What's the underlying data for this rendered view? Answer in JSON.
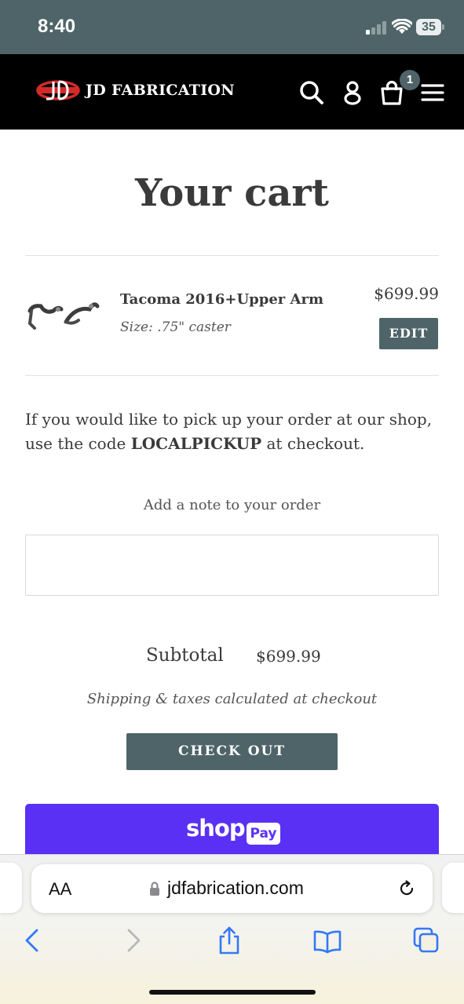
{
  "status_bar": {
    "time": "8:40",
    "battery": "35"
  },
  "header": {
    "brand": "JD FABRICATION",
    "cart_count": "1"
  },
  "cart": {
    "title": "Your cart",
    "items": [
      {
        "name": "Tacoma 2016+Upper Arm",
        "variant": "Size: .75\" caster",
        "price": "$699.99",
        "edit_label": "EDIT"
      }
    ],
    "notice_before": "If you would like to pick up your order at our shop, use the code ",
    "notice_code": "LOCALPICKUP",
    "notice_after": " at checkout.",
    "note_label": "Add a note to your order",
    "note_value": "",
    "subtotal_label": "Subtotal",
    "subtotal_value": "$699.99",
    "shipping_note": "Shipping & taxes calculated at checkout",
    "checkout_label": "CHECK OUT",
    "shop_pay": {
      "word": "shop",
      "pill": "Pay"
    }
  },
  "browser": {
    "text_size_label": "AA",
    "url": "jdfabrication.com"
  },
  "colors": {
    "accent": "#4e6468",
    "header_bg": "#000000",
    "logo_red": "#d42a2a",
    "shop_pay": "#5a31f4",
    "safari_blue": "#3478f6"
  }
}
